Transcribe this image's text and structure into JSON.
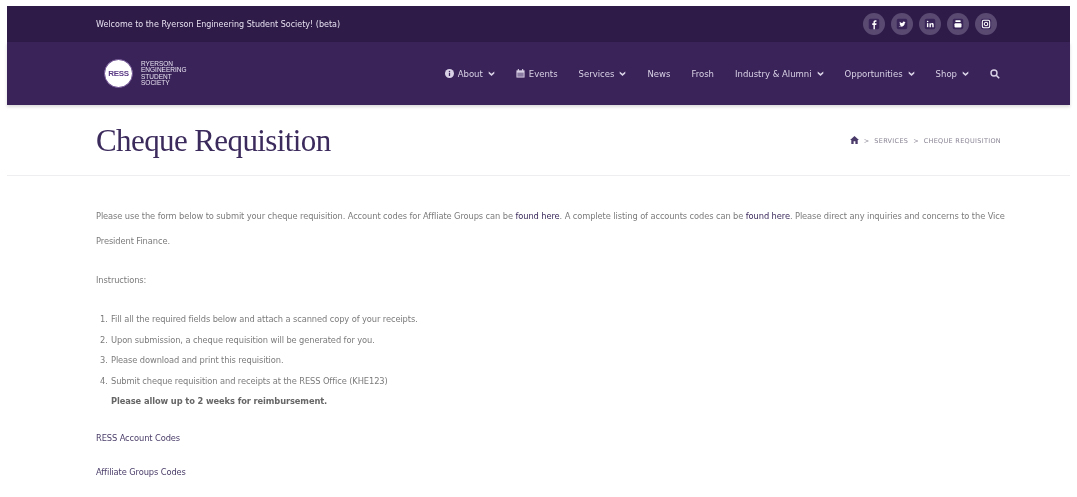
{
  "top_bar": {
    "welcome": "Welcome to the Ryerson Engineering Student Society! (beta)",
    "social": [
      {
        "kind": "facebook"
      },
      {
        "kind": "twitter"
      },
      {
        "kind": "linkedin"
      },
      {
        "kind": "youtube"
      },
      {
        "kind": "instagram"
      }
    ]
  },
  "header": {
    "logo_badge": "RESS",
    "logo_lines": [
      "RYERSON",
      "ENGINEERING",
      "STUDENT",
      "SOCIETY"
    ],
    "nav": [
      {
        "label": "About",
        "kind": "info",
        "dropdown": true
      },
      {
        "label": "Events",
        "kind": "calendar",
        "dropdown": false
      },
      {
        "label": "Services",
        "kind": "plain",
        "dropdown": true
      },
      {
        "label": "News",
        "kind": "plain",
        "dropdown": false
      },
      {
        "label": "Frosh",
        "kind": "plain",
        "dropdown": false
      },
      {
        "label": "Industry & Alumni",
        "kind": "plain",
        "dropdown": true
      },
      {
        "label": "Opportunities",
        "kind": "plain",
        "dropdown": true
      },
      {
        "label": "Shop",
        "kind": "plain",
        "dropdown": true
      }
    ]
  },
  "page_title": "Cheque Requisition",
  "breadcrumb": {
    "separator": ">",
    "items": [
      "SERVICES",
      "CHEQUE REQUISITION"
    ]
  },
  "intro": [
    {
      "kind": "text",
      "text": "Please use the form below to submit your cheque requisition. Account codes for Affliate Groups can be "
    },
    {
      "kind": "link",
      "text": "found here"
    },
    {
      "kind": "text",
      "text": ". A complete listing of accounts codes can be "
    },
    {
      "kind": "link",
      "text": "found here"
    },
    {
      "kind": "text",
      "text": ". Please direct any inquiries and concerns to the Vice President Finance."
    }
  ],
  "instructions_label": "Instructions:",
  "steps": [
    {
      "number": "1.",
      "text": "Fill all the required fields below and attach a scanned copy of your receipts."
    },
    {
      "number": "2.",
      "text": "Upon submission, a cheque requisition will be generated for you."
    },
    {
      "number": "3.",
      "text": "Please download and print this requisition."
    },
    {
      "number": "4.",
      "text": "Submit cheque requisition and receipts at the RESS Office (KHE123)"
    }
  ],
  "note": "Please allow up to 2 weeks for reimbursement.",
  "links": [
    "RESS Account Codes",
    "Affiliate Groups Codes"
  ]
}
